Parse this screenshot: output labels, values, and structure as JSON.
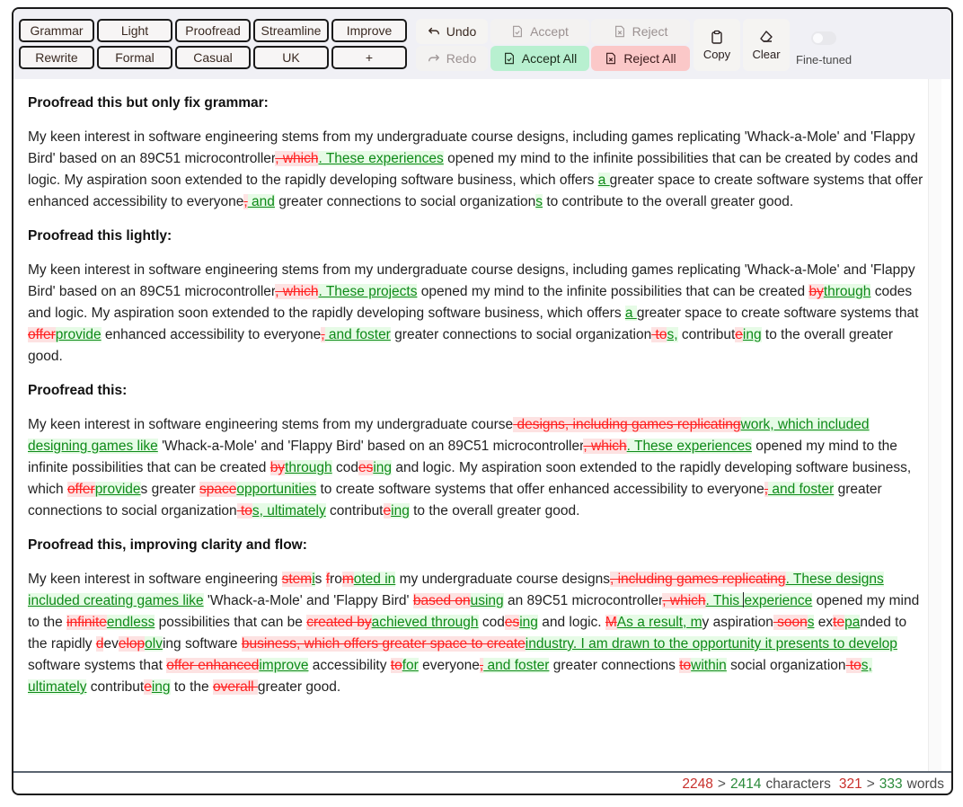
{
  "toolbar": {
    "presets": [
      "Grammar",
      "Light",
      "Proofread",
      "Streamline",
      "Improve",
      "Rewrite",
      "Formal",
      "Casual",
      "UK",
      "+"
    ],
    "undo_label": "Undo",
    "redo_label": "Redo",
    "accept_label": "Accept",
    "reject_label": "Reject",
    "accept_all_label": "Accept All",
    "reject_all_label": "Reject All",
    "copy_label": "Copy",
    "clear_label": "Clear",
    "fine_tuned_label": "Fine-tuned",
    "fine_tuned_on": false
  },
  "sections": [
    {
      "heading": "Proofread this but only fix grammar:",
      "segments": [
        [
          "t",
          "My keen interest in software engineering stems from my undergraduate course designs, including games replicating 'Whack-a-Mole' and 'Flappy Bird' based on an 89C51 microcontroller"
        ],
        [
          "d",
          ", which"
        ],
        [
          "i",
          ". These experiences"
        ],
        [
          "t",
          " opened my mind to the infinite possibilities that can be created by codes and logic. My aspiration soon extended to the rapidly developing software business, which offers "
        ],
        [
          "i",
          "a "
        ],
        [
          "t",
          "greater space to create software systems that offer enhanced accessibility to everyone"
        ],
        [
          "d",
          ","
        ],
        [
          "i",
          " and"
        ],
        [
          "t",
          " greater connections to social organization"
        ],
        [
          "i",
          "s"
        ],
        [
          "t",
          " to contribute to the overall greater good."
        ]
      ]
    },
    {
      "heading": "Proofread this lightly:",
      "segments": [
        [
          "t",
          "My keen interest in software engineering stems from my undergraduate course designs, including games replicating 'Whack-a-Mole' and 'Flappy Bird' based on an 89C51 microcontroller"
        ],
        [
          "d",
          ", which"
        ],
        [
          "i",
          ". These projects"
        ],
        [
          "t",
          " opened my mind to the infinite possibilities that can be created "
        ],
        [
          "d",
          "by"
        ],
        [
          "i",
          "through"
        ],
        [
          "t",
          " codes and logic. My aspiration soon extended to the rapidly developing software business, which offers "
        ],
        [
          "i",
          "a "
        ],
        [
          "t",
          "greater space to create software systems that "
        ],
        [
          "d",
          "offer"
        ],
        [
          "i",
          "provide"
        ],
        [
          "t",
          " enhanced accessibility to everyone"
        ],
        [
          "d",
          ","
        ],
        [
          "i",
          " and foster"
        ],
        [
          "t",
          " greater connections to social organization"
        ],
        [
          "d",
          " to"
        ],
        [
          "i",
          "s,"
        ],
        [
          "t",
          " contribut"
        ],
        [
          "d",
          "e"
        ],
        [
          "i",
          "ing"
        ],
        [
          "t",
          " to the overall greater good."
        ]
      ]
    },
    {
      "heading": "Proofread this:",
      "segments": [
        [
          "t",
          "My keen interest in software engineering stems from my undergraduate course"
        ],
        [
          "d",
          " designs, including games replicating"
        ],
        [
          "i",
          "work, which included designing games like"
        ],
        [
          "t",
          " 'Whack-a-Mole' and 'Flappy Bird' based on an 89C51 microcontroller"
        ],
        [
          "d",
          ", which"
        ],
        [
          "i",
          ". These experiences"
        ],
        [
          "t",
          " opened my mind to the infinite possibilities that can be created "
        ],
        [
          "d",
          "by"
        ],
        [
          "i",
          "through"
        ],
        [
          "t",
          " cod"
        ],
        [
          "d",
          "es"
        ],
        [
          "i",
          "ing"
        ],
        [
          "t",
          " and logic. My aspiration soon extended to the rapidly developing software business, which "
        ],
        [
          "d",
          "offer"
        ],
        [
          "i",
          "provide"
        ],
        [
          "t",
          "s greater "
        ],
        [
          "d",
          "space"
        ],
        [
          "i",
          "opportunities"
        ],
        [
          "t",
          " to create software systems that offer enhanced accessibility to everyone"
        ],
        [
          "d",
          ","
        ],
        [
          "i",
          " and foster"
        ],
        [
          "t",
          " greater connections to social organization"
        ],
        [
          "d",
          " to"
        ],
        [
          "i",
          "s, ultimately"
        ],
        [
          "t",
          " contribut"
        ],
        [
          "d",
          "e"
        ],
        [
          "i",
          "ing"
        ],
        [
          "t",
          " to the overall greater good."
        ]
      ]
    },
    {
      "heading": "Proofread this, improving clarity and flow:",
      "segments": [
        [
          "t",
          "My keen interest in software engineering "
        ],
        [
          "d",
          "stem"
        ],
        [
          "i",
          "i"
        ],
        [
          "t",
          "s "
        ],
        [
          "d",
          "f"
        ],
        [
          "t",
          "ro"
        ],
        [
          "d",
          "m"
        ],
        [
          "i",
          "oted in"
        ],
        [
          "t",
          " my undergraduate course designs"
        ],
        [
          "d",
          ", including games replicating"
        ],
        [
          "i",
          ". These designs included creating games like"
        ],
        [
          "t",
          " 'Whack-a-Mole' and 'Flappy Bird' "
        ],
        [
          "d",
          "based on"
        ],
        [
          "i",
          "using"
        ],
        [
          "t",
          " an 89C51 microcontroller"
        ],
        [
          "d",
          ", which"
        ],
        [
          "i",
          ". This "
        ],
        [
          "c",
          ""
        ],
        [
          "i",
          "experience"
        ],
        [
          "t",
          " opened my mind to the "
        ],
        [
          "d",
          "infinite"
        ],
        [
          "i",
          "endless"
        ],
        [
          "t",
          " possibilities that can be "
        ],
        [
          "d",
          "created by"
        ],
        [
          "i",
          "achieved through"
        ],
        [
          "t",
          " cod"
        ],
        [
          "d",
          "es"
        ],
        [
          "i",
          "ing"
        ],
        [
          "t",
          " and logic. "
        ],
        [
          "d",
          "M"
        ],
        [
          "i",
          "As a result, m"
        ],
        [
          "t",
          "y aspiration"
        ],
        [
          "d",
          " soon"
        ],
        [
          "i",
          "s"
        ],
        [
          "t",
          " ex"
        ],
        [
          "d",
          "te"
        ],
        [
          "i",
          "pa"
        ],
        [
          "t",
          "nded to the rapidly "
        ],
        [
          "d",
          "d"
        ],
        [
          "t",
          "ev"
        ],
        [
          "d",
          "elop"
        ],
        [
          "i",
          "olv"
        ],
        [
          "t",
          "ing software "
        ],
        [
          "d",
          "business, which offers greater space to create"
        ],
        [
          "i",
          "industry. I am drawn to the opportunity it presents to develop"
        ],
        [
          "t",
          " software systems that "
        ],
        [
          "d",
          "offer enhanced"
        ],
        [
          "i",
          "improve"
        ],
        [
          "t",
          " accessibility "
        ],
        [
          "d",
          "to"
        ],
        [
          "i",
          "for"
        ],
        [
          "t",
          " everyone"
        ],
        [
          "d",
          ","
        ],
        [
          "i",
          " and foster"
        ],
        [
          "t",
          " greater connections "
        ],
        [
          "d",
          "to"
        ],
        [
          "i",
          "within"
        ],
        [
          "t",
          " social organization"
        ],
        [
          "d",
          " to"
        ],
        [
          "i",
          "s, ultimately"
        ],
        [
          "t",
          " contribut"
        ],
        [
          "d",
          "e"
        ],
        [
          "i",
          "ing"
        ],
        [
          "t",
          " to the "
        ],
        [
          "d",
          "overall "
        ],
        [
          "t",
          "greater good."
        ]
      ]
    }
  ],
  "footer": {
    "chars_before": "2248",
    "chars_after": "2414",
    "chars_label": "characters",
    "words_before": "321",
    "words_after": "333",
    "words_label": "words",
    "arrow": ">"
  },
  "colors": {
    "deletion": "#ff2020",
    "deletion_bg": "#fde2e2",
    "insertion": "#0e8a18",
    "insertion_bg": "#e6fbe6",
    "accept_all_bg": "#b8f0d0",
    "reject_all_bg": "#fbc8c8"
  }
}
